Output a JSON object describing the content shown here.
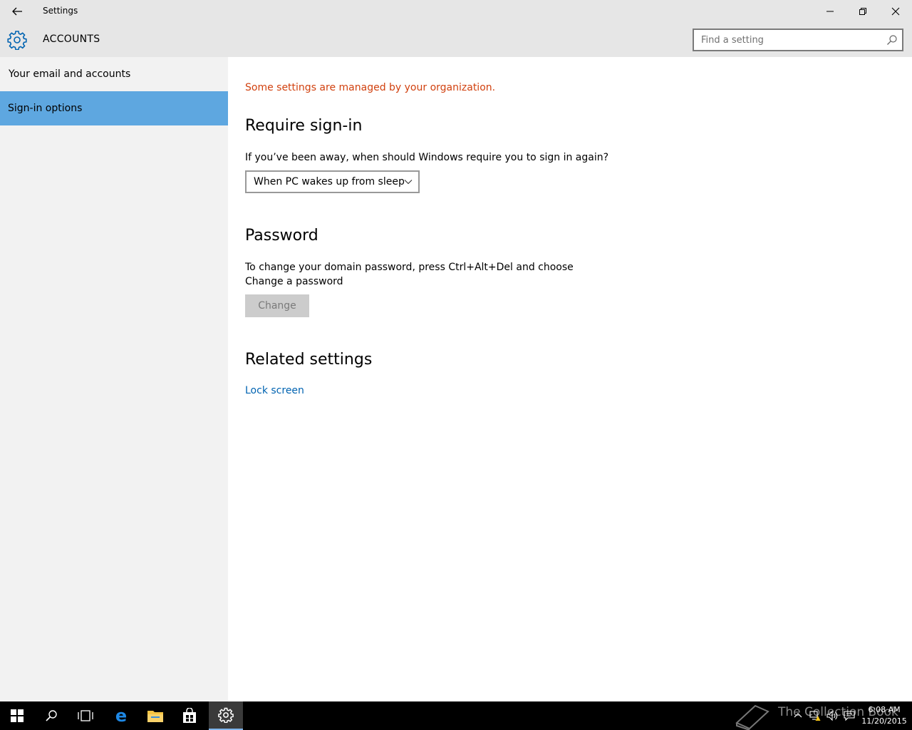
{
  "window": {
    "title": "Settings"
  },
  "header": {
    "section_title": "ACCOUNTS",
    "search_placeholder": "Find a setting"
  },
  "sidebar": {
    "items": [
      {
        "label": "Your email and accounts",
        "active": false
      },
      {
        "label": "Sign-in options",
        "active": true
      }
    ]
  },
  "main": {
    "managed_notice": "Some settings are managed by your organization.",
    "require_signin": {
      "heading": "Require sign-in",
      "question": "If you’ve been away, when should Windows require you to sign in again?",
      "selected_option": "When PC wakes up from sleep"
    },
    "password": {
      "heading": "Password",
      "description_line1": "To change your domain password, press Ctrl+Alt+Del and choose",
      "description_line2": "Change a password",
      "change_button": "Change"
    },
    "related": {
      "heading": "Related settings",
      "lock_screen_link": "Lock screen"
    }
  },
  "taskbar": {
    "watermark": "The Collection Book",
    "time": "6:08 AM",
    "date": "11/20/2015"
  },
  "colors": {
    "accent": "#5ea7e0",
    "warning_text": "#d1410f",
    "link": "#0063b1",
    "chrome": "#e6e6e6",
    "sidebar": "#f2f2f2",
    "gear": "#0063b1"
  }
}
